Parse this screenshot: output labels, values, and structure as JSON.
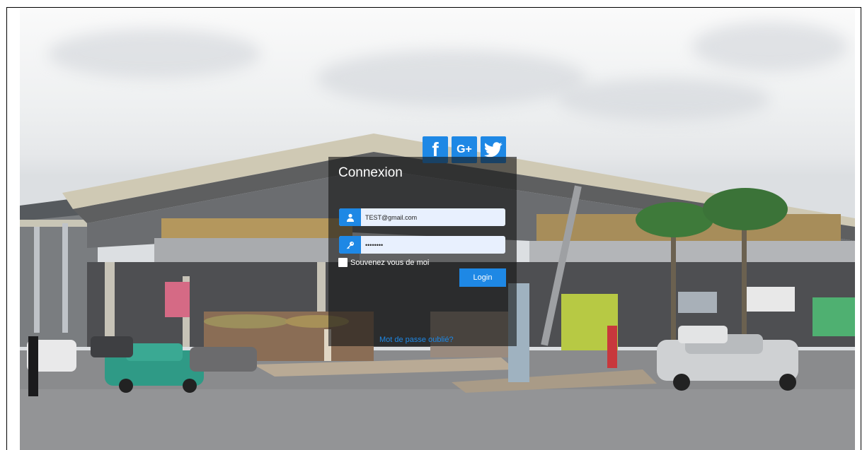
{
  "social": {
    "facebook": {
      "icon": "facebook-icon",
      "glyph": "f"
    },
    "google_plus": {
      "icon": "google-plus-icon",
      "glyph": "G+"
    },
    "twitter": {
      "icon": "twitter-icon"
    }
  },
  "login": {
    "title": "Connexion",
    "email": {
      "value": "TEST@gmail.com",
      "icon": "user-icon"
    },
    "password": {
      "value": "••••••••",
      "icon": "key-icon"
    },
    "remember_label": "Souvenez vous de moi",
    "remember_checked": false,
    "submit_label": "Login",
    "forgot_link": "Mot de passe oublié?"
  },
  "colors": {
    "accent": "#1e88e5",
    "panel": "rgba(22,22,22,0.62)",
    "field_bg": "#e8f0fe"
  }
}
